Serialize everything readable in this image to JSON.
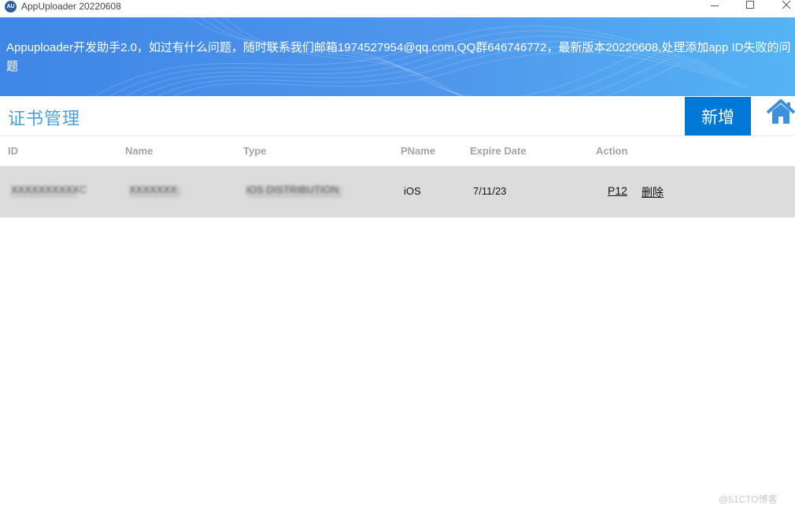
{
  "window": {
    "icon_text": "AU",
    "title": "AppUploader 20220608"
  },
  "banner": {
    "text": "Appuploader开发助手2.0，如过有什么问题，随时联系我们邮箱1974527954@qq.com,QQ群646746772，最新版本20220608,处理添加app ID失败的问题"
  },
  "header": {
    "title": "证书管理",
    "add_label": "新增"
  },
  "table": {
    "columns": [
      "ID",
      "Name",
      "Type",
      "PName",
      "Expire Date",
      "Action"
    ],
    "rows": [
      {
        "id": "XXXXXXXXXXC",
        "name": "XXXXXXX",
        "type": "iOS DISTRIBUTION",
        "pname": "iOS",
        "expire_date": "7/11/23",
        "action_p12": "P12",
        "action_delete": "删除"
      }
    ]
  },
  "watermark": "@51CTO博客",
  "colors": {
    "accent": "#0078d7",
    "title": "#4a9fe0",
    "row_bg": "#dcdcdc"
  }
}
